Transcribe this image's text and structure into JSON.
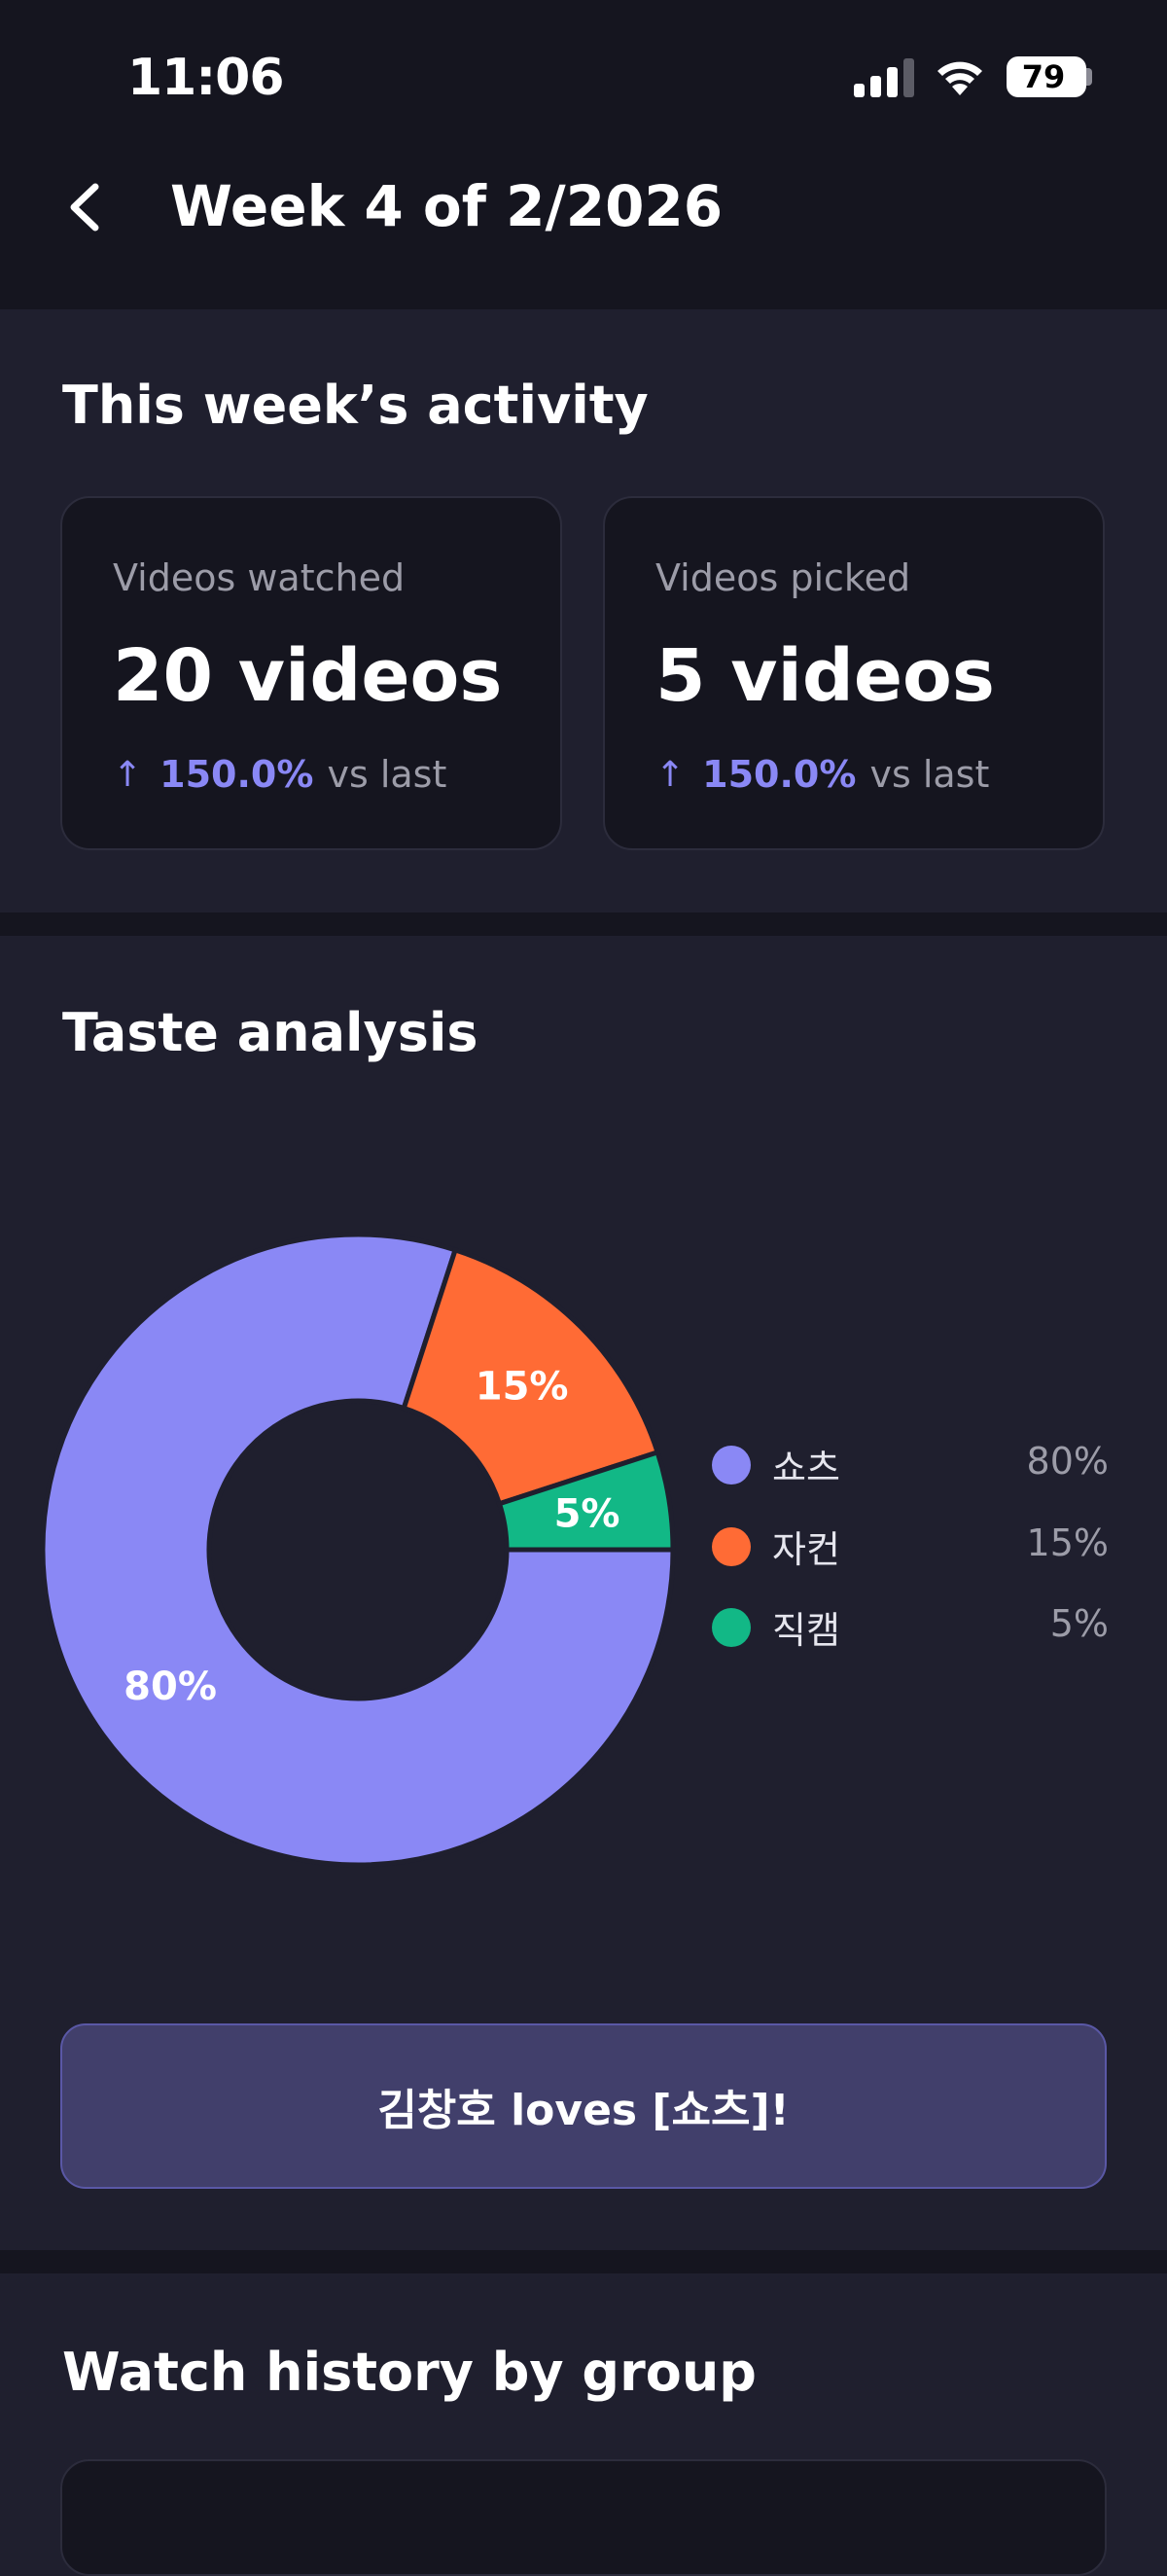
{
  "status_bar": {
    "time": "11:06",
    "battery": "79"
  },
  "header": {
    "title": "Week 4 of 2/2026"
  },
  "activity": {
    "title": "This week’s activity",
    "cards": [
      {
        "label": "Videos watched",
        "value": "20 videos",
        "arrow": "↑",
        "change": "150.0%",
        "compare": "vs last"
      },
      {
        "label": "Videos picked",
        "value": "5 videos",
        "arrow": "↑",
        "change": "150.0%",
        "compare": "vs last"
      }
    ]
  },
  "taste": {
    "title": "Taste analysis",
    "legend": [
      {
        "name": "쇼츠",
        "pct": "80%"
      },
      {
        "name": "자컨",
        "pct": "15%"
      },
      {
        "name": "직캠",
        "pct": "5%"
      }
    ],
    "banner": "김창호 loves [쇼츠]!"
  },
  "history": {
    "title": "Watch history by group"
  },
  "colors": {
    "purple": "#8a88f5",
    "orange": "#ff6b35",
    "green": "#12b886",
    "background": "#1f1f2e",
    "card": "#15151f"
  },
  "chart_data": {
    "type": "pie",
    "categories": [
      "쇼츠",
      "자컨",
      "직캠"
    ],
    "values": [
      80,
      15,
      5
    ],
    "labels": [
      "80%",
      "15%",
      "5%"
    ],
    "colors": [
      "#8a88f5",
      "#ff6b35",
      "#12b886"
    ],
    "legend": "right"
  }
}
